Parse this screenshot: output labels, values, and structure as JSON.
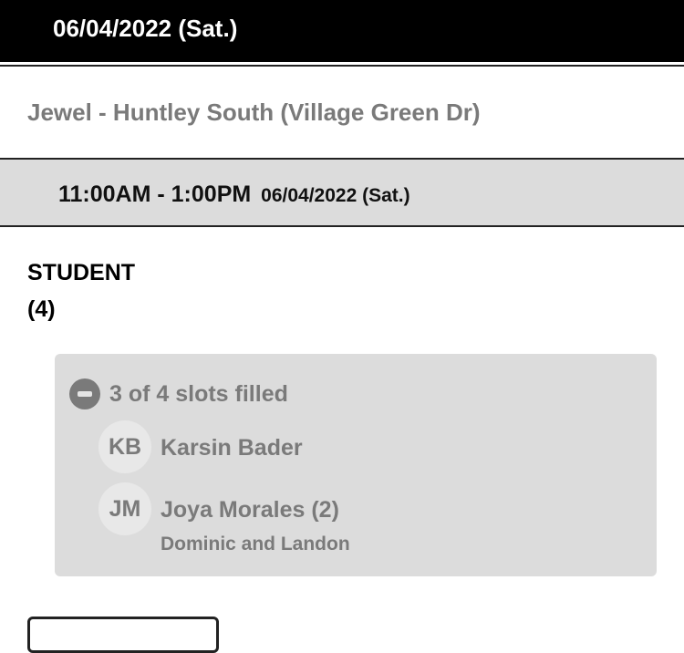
{
  "header": {
    "date": "06/04/2022 (Sat.)"
  },
  "location": {
    "name": "Jewel - Huntley South (Village Green Dr)"
  },
  "shift": {
    "time_range": "11:00AM - 1:00PM",
    "date": "06/04/2022 (Sat.)"
  },
  "role": {
    "title": "STUDENT",
    "count": "(4)"
  },
  "slots": {
    "summary": "3 of 4 slots filled",
    "volunteers": [
      {
        "initials": "KB",
        "name": "Karsin Bader"
      },
      {
        "initials": "JM",
        "name": "Joya Morales (2)",
        "detail": "Dominic and Landon"
      }
    ]
  },
  "colors": {
    "header_bg": "#000000",
    "muted_text": "#7a7a7a",
    "panel_bg": "#dcdcdc"
  }
}
